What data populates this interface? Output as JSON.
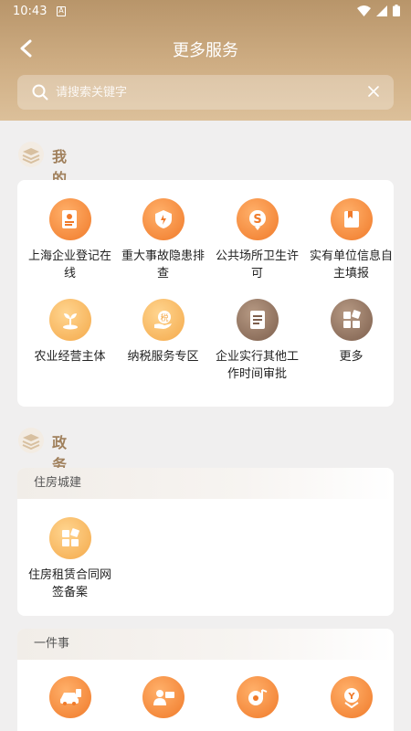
{
  "status": {
    "time": "10:43"
  },
  "header": {
    "title": "更多服务"
  },
  "search": {
    "placeholder": "请搜索关键字"
  },
  "my_services": {
    "title": "我的服务",
    "items": [
      {
        "label": "上海企业登记在线",
        "icon": "id-card-icon",
        "color": "orange"
      },
      {
        "label": "重大事故隐患排查",
        "icon": "shield-alert-icon",
        "color": "orange"
      },
      {
        "label": "公共场所卫生许可",
        "icon": "s-badge-icon",
        "color": "orange"
      },
      {
        "label": "实有单位信息自主填报",
        "icon": "bookmark-doc-icon",
        "color": "orange"
      },
      {
        "label": "农业经营主体",
        "icon": "sprout-icon",
        "color": "yellow"
      },
      {
        "label": "纳税服务专区",
        "icon": "tax-hand-icon",
        "color": "yellow"
      },
      {
        "label": "企业实行其他工作时间审批",
        "icon": "document-icon",
        "color": "brown"
      },
      {
        "label": "更多",
        "icon": "apps-grid-icon",
        "color": "brown"
      }
    ]
  },
  "gov_services": {
    "title": "政务服务",
    "groups": [
      {
        "name": "住房城建",
        "items": [
          {
            "label": "住房租赁合同网签备案",
            "icon": "apps-grid-icon",
            "color": "yellow"
          }
        ]
      },
      {
        "name": "一件事",
        "items": [
          {
            "label": "",
            "icon": "car-icon",
            "color": "orange"
          },
          {
            "label": "",
            "icon": "person-card-icon",
            "color": "orange"
          },
          {
            "label": "",
            "icon": "music-disc-icon",
            "color": "orange"
          },
          {
            "label": "",
            "icon": "yuan-shield-icon",
            "color": "orange"
          }
        ]
      }
    ]
  }
}
